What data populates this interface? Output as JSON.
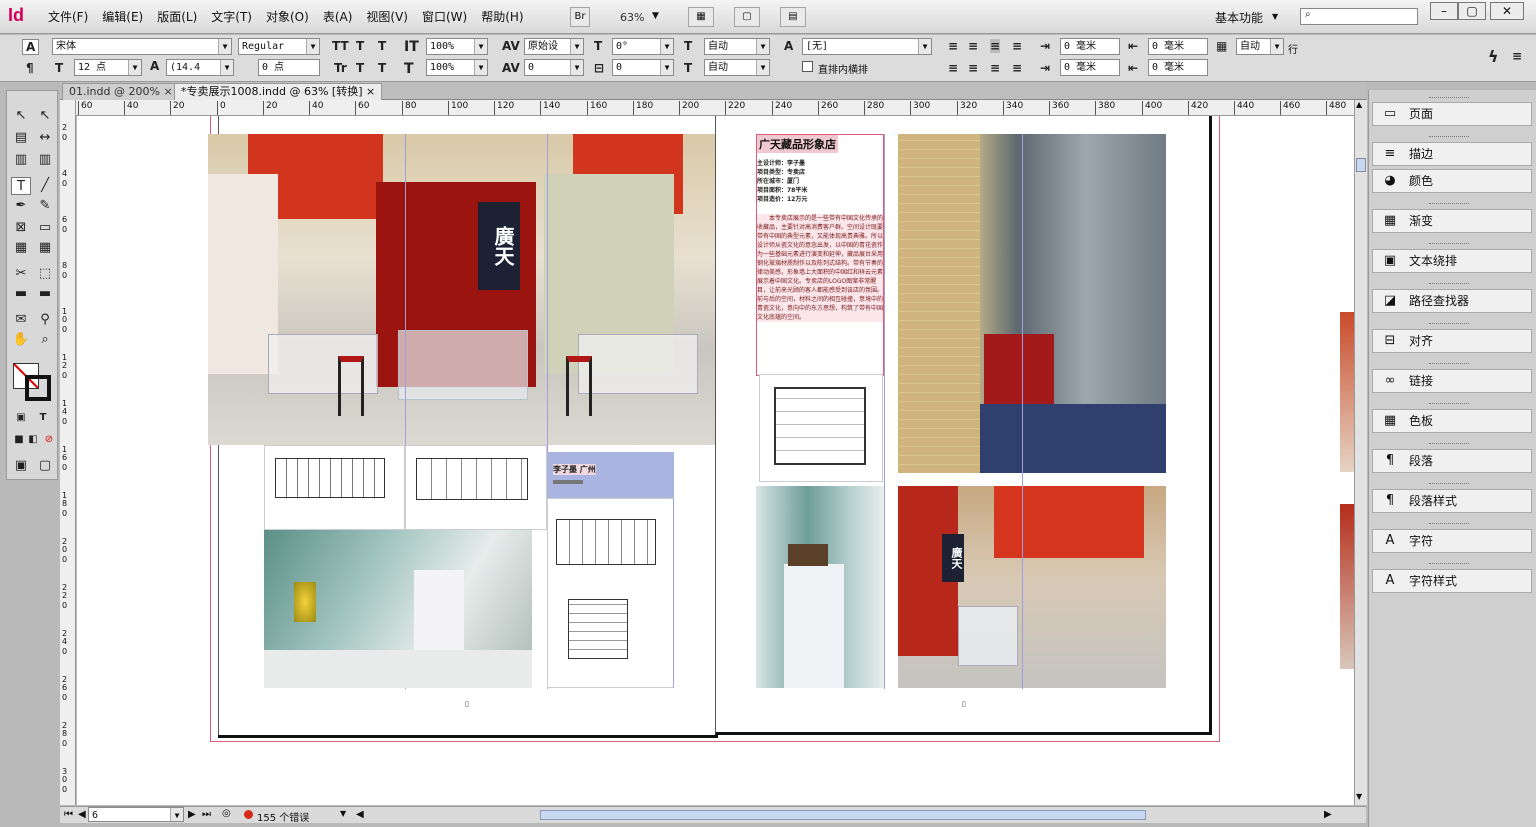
{
  "app": {
    "logo": "Id"
  },
  "menu": [
    "文件(F)",
    "编辑(E)",
    "版面(L)",
    "文字(T)",
    "对象(O)",
    "表(A)",
    "视图(V)",
    "窗口(W)",
    "帮助(H)"
  ],
  "appbar": {
    "bridge_label": "Br",
    "zoom": "63%",
    "workspace": "基本功能"
  },
  "control": {
    "char_mode": "A",
    "para_mode": "¶",
    "font_family": "宋体",
    "font_style": "Regular",
    "font_size": "12 点",
    "leading": "(14.4",
    "kerning_label": "原始设",
    "tracking": "0",
    "baseline_shift": "0 点",
    "vscale": "100%",
    "hscale": "100%",
    "skew": "0°",
    "rotate": "0",
    "auto1": "自动",
    "auto2": "自动",
    "char_style": "[无]",
    "check_label": "直排内横排",
    "indent_left": "0 毫米",
    "indent_right": "0 毫米",
    "indent_first": "0 毫米",
    "indent_last": "0 毫米",
    "grid_auto": "自动",
    "grid_unit": "行"
  },
  "tabs": [
    {
      "label": "01.indd @ 200%",
      "close": "×"
    },
    {
      "label": "*专卖展示1008.indd @ 63% [转换]",
      "close": "×"
    }
  ],
  "ruler_h": [
    "60",
    "40",
    "20",
    "0",
    "20",
    "40",
    "60",
    "80",
    "100",
    "120",
    "140",
    "160",
    "180",
    "200",
    "220",
    "240",
    "260",
    "280",
    "300",
    "320",
    "340",
    "360",
    "380",
    "400",
    "420",
    "440",
    "460",
    "480"
  ],
  "ruler_v": [
    "2",
    "0",
    "4",
    "0",
    "6",
    "0",
    "8",
    "0",
    "10",
    "0",
    "12",
    "0",
    "14",
    "0",
    "16",
    "0",
    "18",
    "0",
    "20",
    "0",
    "22",
    "0",
    "24",
    "0",
    "26",
    "0",
    "28",
    "0",
    "30",
    "0"
  ],
  "doc": {
    "sign_text": "廣天",
    "title": "广天藏品形象店",
    "info": [
      "主设计师：李子墨",
      "项目类型：专卖店",
      "所在城市：厦门",
      "项目面积：78平米",
      "项目造价：12万元"
    ],
    "body": "本专卖店展示的是一些带有中国文化传承的收藏品，主要针对高消费客户群。空间设计既要带有中国的典型元素，又能体现高贵典雅。所以设计师从瓷文化的意念出发，以中国的青花瓷作为一些基础元素进行演变和延伸，藏品展台采用钢化玻璃材质制作以及陈列式结构。带有节奏的律动美感，形象墙上大面积的中国红和祥云元素展示着中国文化。专卖店的LOGO图案非常醒目，让前来光顾的客人都能感受到该店的氛围。前与后的空间，材料之间的相互碰撞，意境中的青瓷文化，意向中的东方思想，构筑了带有中国文化底蕴的空间。",
    "caption_name": "李子墨 广州",
    "page_mark_left": "▯",
    "page_mark_right": "▯"
  },
  "status": {
    "page": "6",
    "errors": "155 个错误"
  },
  "panels": [
    {
      "icon": "▭",
      "label": "页面"
    },
    {
      "icon": "≡",
      "label": "描边"
    },
    {
      "icon": "◕",
      "label": "颜色"
    },
    {
      "icon": "▦",
      "label": "渐变"
    },
    {
      "icon": "▣",
      "label": "文本绕排"
    },
    {
      "icon": "◪",
      "label": "路径查找器"
    },
    {
      "icon": "⊟",
      "label": "对齐"
    },
    {
      "icon": "∞",
      "label": "链接"
    },
    {
      "icon": "▦",
      "label": "色板"
    },
    {
      "icon": "¶",
      "label": "段落"
    },
    {
      "icon": "¶",
      "label": "段落样式"
    },
    {
      "icon": "A",
      "label": "字符"
    },
    {
      "icon": "A",
      "label": "字符样式"
    }
  ],
  "colors": {
    "accent": "#d1005c",
    "china_red": "#c8341f",
    "guide_blue": "#9f9fe0",
    "bleed_pink": "#e05a7a"
  }
}
